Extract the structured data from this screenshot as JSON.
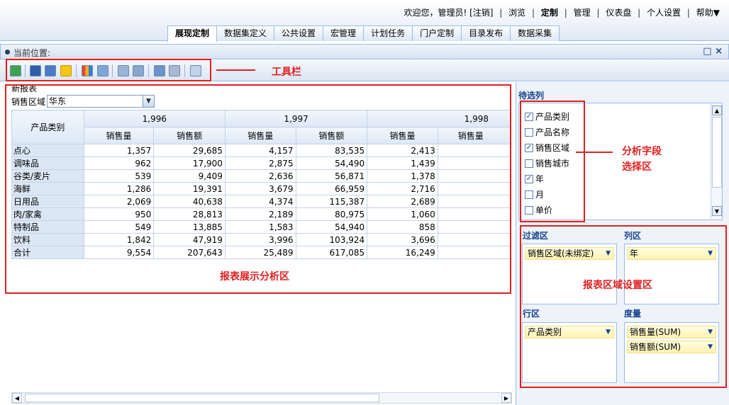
{
  "header": {
    "welcome": "欢迎您，管理员! [注销]",
    "links": [
      "浏览",
      "定制",
      "管理",
      "仪表盘",
      "个人设置",
      "帮助▼"
    ]
  },
  "tabs": [
    {
      "label": "展现定制",
      "active": true
    },
    {
      "label": "数据集定义",
      "active": false
    },
    {
      "label": "公共设置",
      "active": false
    },
    {
      "label": "宏管理",
      "active": false
    },
    {
      "label": "计划任务",
      "active": false
    },
    {
      "label": "门户定制",
      "active": false
    },
    {
      "label": "目录发布",
      "active": false
    },
    {
      "label": "数据采集",
      "active": false
    }
  ],
  "location": {
    "label": "当前位置:",
    "window_icons": "□ ×"
  },
  "annotations": {
    "toolbar": "工具栏",
    "report_area": "报表展示分析区",
    "field_area_line1": "分析字段",
    "field_area_line2": "选择区",
    "settings_area": "报表区域设置区"
  },
  "report": {
    "title": "新报表",
    "filter_label": "销售区域",
    "filter_value": "华东",
    "row_header": "产品类别",
    "years": [
      "1,996",
      "1,997",
      "1,998"
    ],
    "measures": [
      "销售量",
      "销售额"
    ],
    "rows": [
      {
        "label": "点心",
        "values": [
          "1,357",
          "29,685",
          "4,157",
          "83,535",
          "2,413",
          ""
        ]
      },
      {
        "label": "调味品",
        "values": [
          "962",
          "17,900",
          "2,875",
          "54,490",
          "1,439",
          ""
        ]
      },
      {
        "label": "谷类/麦片",
        "values": [
          "539",
          "9,409",
          "2,636",
          "56,871",
          "1,378",
          ""
        ]
      },
      {
        "label": "海鲜",
        "values": [
          "1,286",
          "19,391",
          "3,679",
          "66,959",
          "2,716",
          ""
        ]
      },
      {
        "label": "日用品",
        "values": [
          "2,069",
          "40,638",
          "4,374",
          "115,387",
          "2,689",
          ""
        ]
      },
      {
        "label": "肉/家禽",
        "values": [
          "950",
          "28,813",
          "2,189",
          "80,975",
          "1,060",
          ""
        ]
      },
      {
        "label": "特制品",
        "values": [
          "549",
          "13,885",
          "1,583",
          "54,940",
          "858",
          ""
        ]
      },
      {
        "label": "饮料",
        "values": [
          "1,842",
          "47,919",
          "3,996",
          "103,924",
          "3,696",
          ""
        ]
      },
      {
        "label": "合计",
        "values": [
          "9,554",
          "207,643",
          "25,489",
          "617,085",
          "16,249",
          ""
        ]
      }
    ]
  },
  "panel": {
    "candidates_title": "待选列",
    "fields": [
      {
        "label": "产品类别",
        "checked": true
      },
      {
        "label": "产品名称",
        "checked": false
      },
      {
        "label": "销售区域",
        "checked": true
      },
      {
        "label": "销售城市",
        "checked": false
      },
      {
        "label": "年",
        "checked": true
      },
      {
        "label": "月",
        "checked": false
      },
      {
        "label": "单价",
        "checked": false
      }
    ],
    "filter_title": "过滤区",
    "filter_items": [
      "销售区域(未绑定)"
    ],
    "column_title": "列区",
    "column_items": [
      "年"
    ],
    "row_title": "行区",
    "row_items": [
      "产品类别"
    ],
    "measure_title": "度量",
    "measure_items": [
      "销售量(SUM)",
      "销售额(SUM)"
    ]
  },
  "colors": {
    "accent": "#15428b",
    "annotation_red": "#e02020",
    "border_blue": "#99bbe8"
  }
}
